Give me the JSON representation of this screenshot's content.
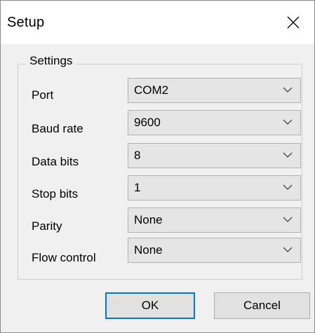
{
  "window": {
    "title": "Setup"
  },
  "settings": {
    "legend": "Settings",
    "rows": [
      {
        "label": "Port",
        "value": "COM2"
      },
      {
        "label": "Baud rate",
        "value": "9600"
      },
      {
        "label": "Data bits",
        "value": "8"
      },
      {
        "label": "Stop bits",
        "value": "1"
      },
      {
        "label": "Parity",
        "value": "None"
      },
      {
        "label": "Flow control",
        "value": "None"
      }
    ]
  },
  "buttons": {
    "ok": "OK",
    "cancel": "Cancel"
  },
  "colors": {
    "default_button_border": "#0078d7",
    "combo_background": "#e5e5e5"
  },
  "icons": {
    "close": "close-icon",
    "dropdown": "chevron-down-icon"
  }
}
